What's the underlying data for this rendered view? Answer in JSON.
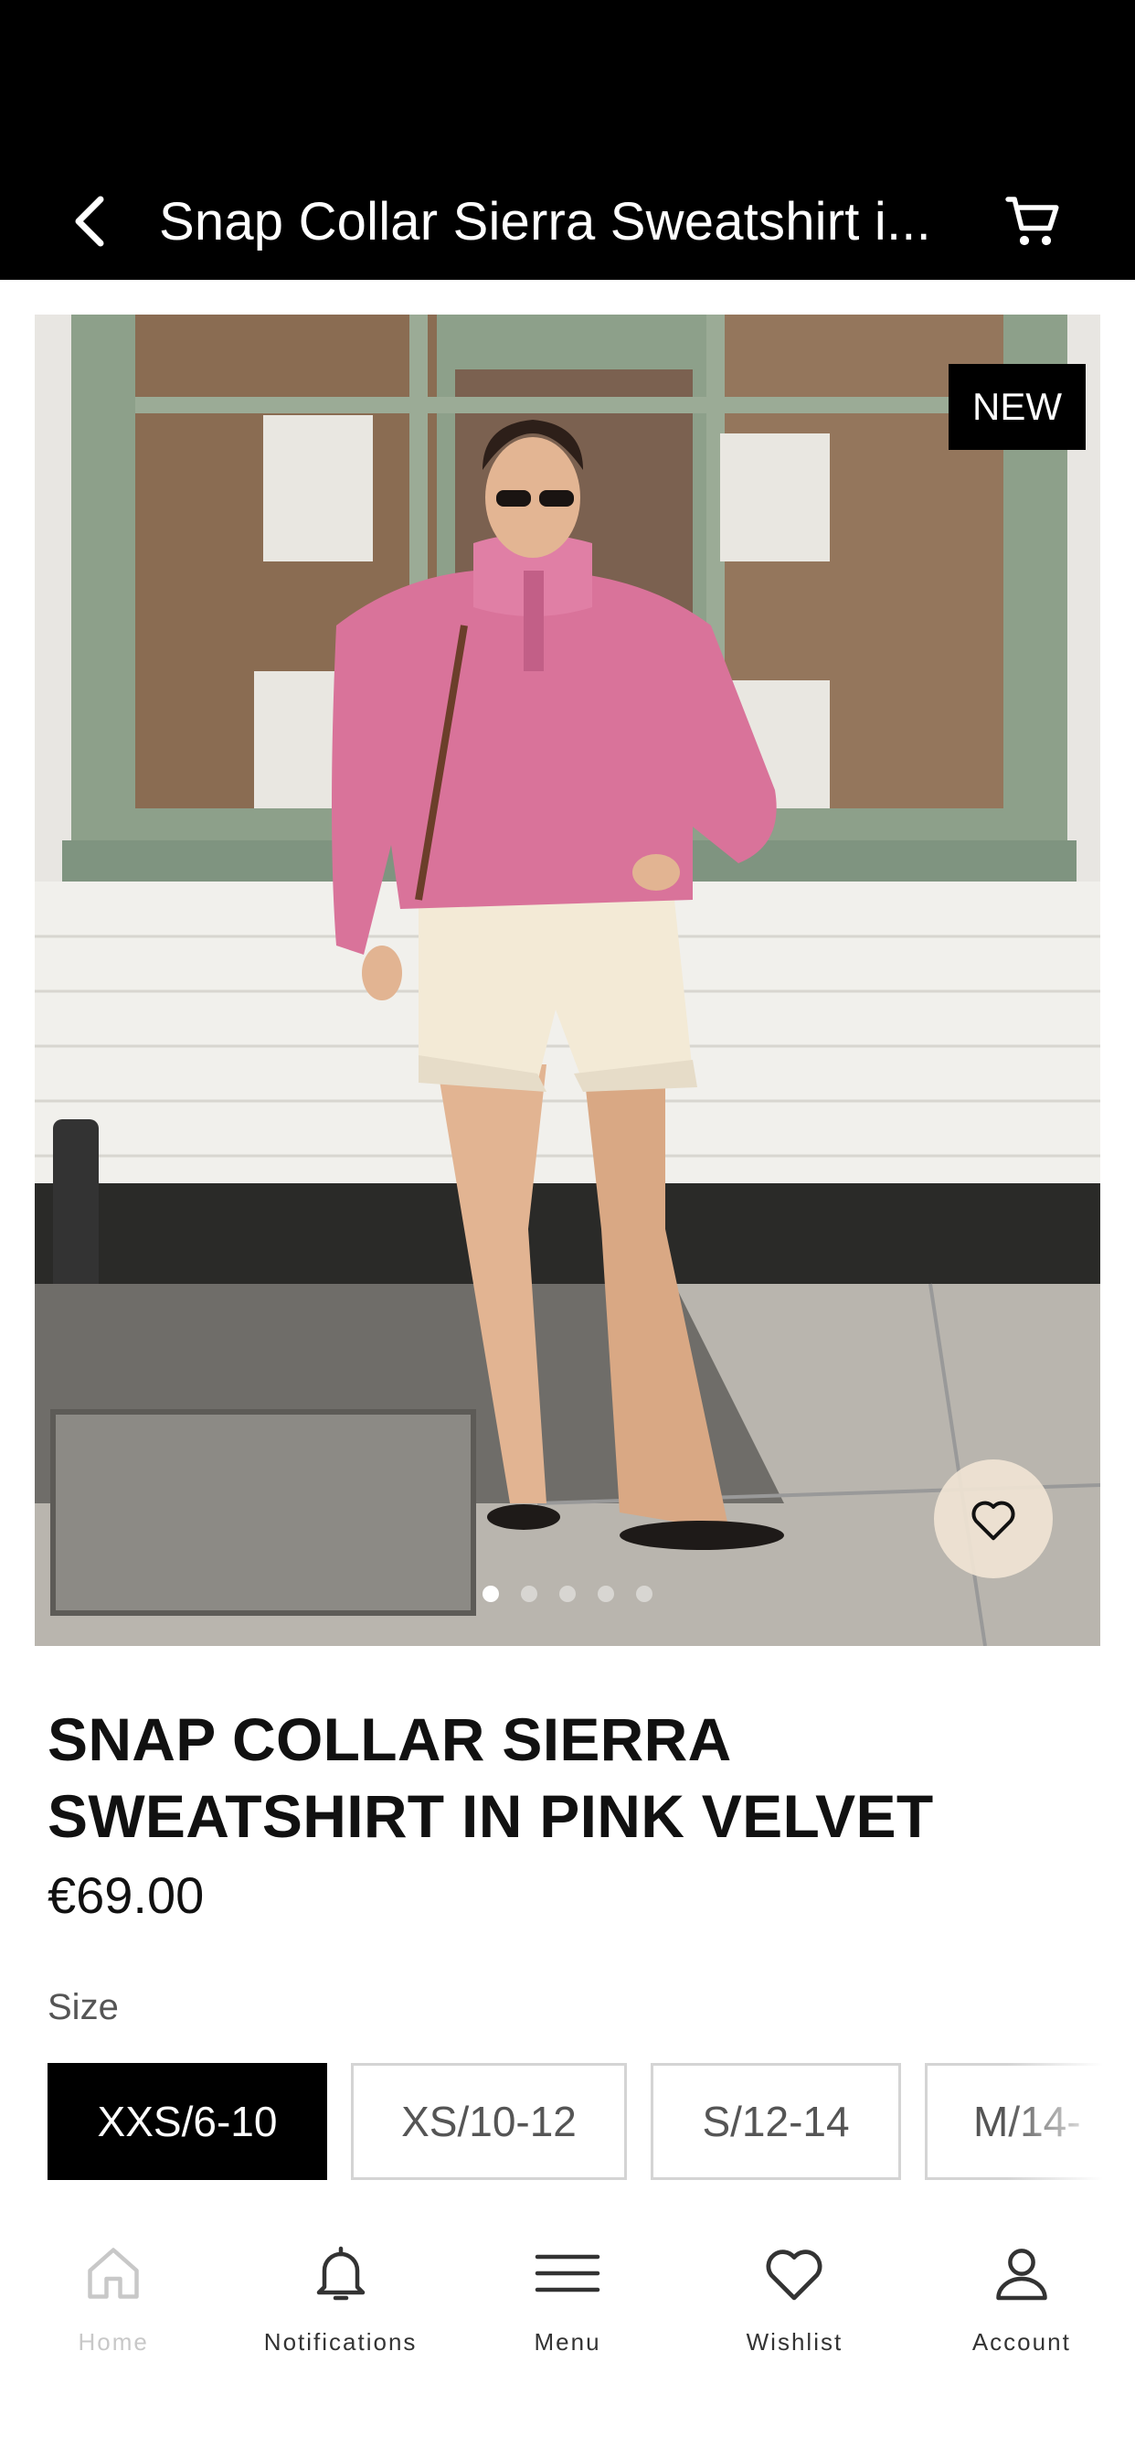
{
  "header": {
    "title": "Snap Collar Sierra Sweatshirt i...",
    "back_icon": "chevron-left-icon",
    "cart_icon": "cart-icon"
  },
  "gallery": {
    "badge": "NEW",
    "image_count": 5,
    "active_index": 0,
    "wishlist_icon": "heart-outline-icon"
  },
  "product": {
    "name_line1": "SNAP COLLAR SIERRA",
    "name_line2": "SWEATSHIRT IN PINK VELVET",
    "price": "€69.00"
  },
  "sizes": {
    "label": "Size",
    "options": [
      "XXS/6-10",
      "XS/10-12",
      "S/12-14",
      "M/14-"
    ],
    "selected_index": 0
  },
  "nav": {
    "items": [
      {
        "label": "Home",
        "icon": "home-icon"
      },
      {
        "label": "Notifications",
        "icon": "bell-icon"
      },
      {
        "label": "Menu",
        "icon": "menu-icon"
      },
      {
        "label": "Wishlist",
        "icon": "heart-icon"
      },
      {
        "label": "Account",
        "icon": "user-icon"
      }
    ]
  },
  "colors": {
    "bar_bg": "#000000",
    "selected_size_bg": "#000000",
    "dim_label": "#c8c8c8"
  }
}
